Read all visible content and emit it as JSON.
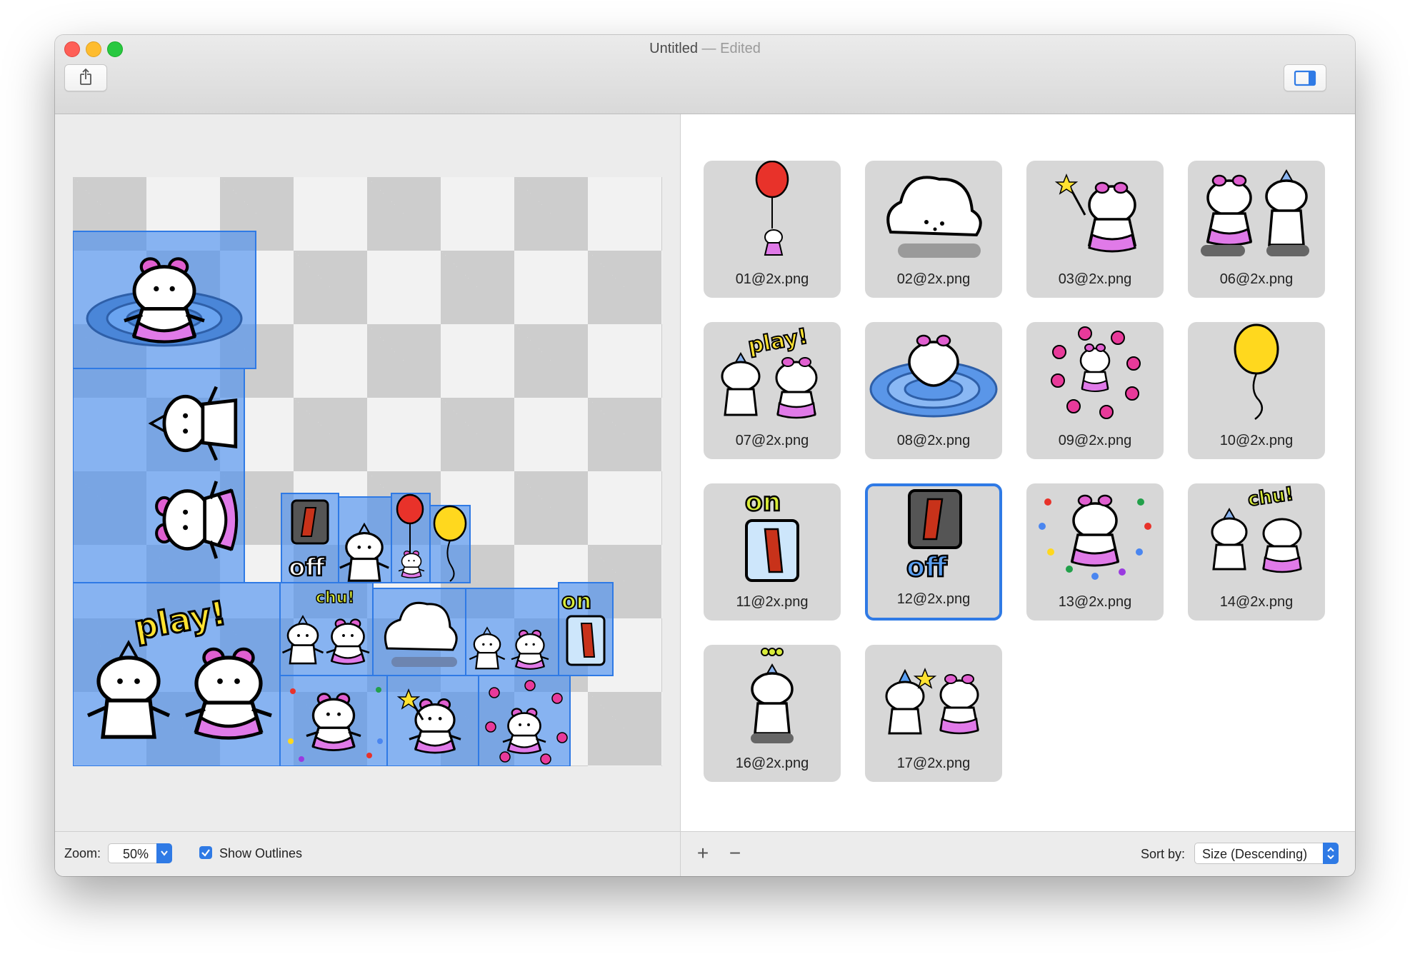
{
  "window": {
    "title": "Untitled",
    "title_suffix": "— Edited"
  },
  "colors": {
    "accent": "#2f7ae5",
    "sprite_overlay": "#468cf0",
    "tile_bg": "#d7d7d7"
  },
  "toolbar": {
    "share_icon": "share-icon",
    "sidebar_icon": "sidebar-toggle-icon"
  },
  "sprites": {
    "items": [
      {
        "name": "01@2x.png",
        "motif": "balloon-red",
        "selected": false
      },
      {
        "name": "02@2x.png",
        "motif": "cloud",
        "selected": false
      },
      {
        "name": "03@2x.png",
        "motif": "wand-girl",
        "selected": false
      },
      {
        "name": "06@2x.png",
        "motif": "pair",
        "selected": false
      },
      {
        "name": "07@2x.png",
        "motif": "play-pair",
        "selected": false
      },
      {
        "name": "08@2x.png",
        "motif": "ripple-girl",
        "selected": false
      },
      {
        "name": "09@2x.png",
        "motif": "hearts-girl",
        "selected": false
      },
      {
        "name": "10@2x.png",
        "motif": "balloon-yellow",
        "selected": false
      },
      {
        "name": "11@2x.png",
        "motif": "switch-on",
        "selected": false
      },
      {
        "name": "12@2x.png",
        "motif": "switch-off",
        "selected": true
      },
      {
        "name": "13@2x.png",
        "motif": "stars-girl",
        "selected": false
      },
      {
        "name": "14@2x.png",
        "motif": "chu-pair",
        "selected": false
      },
      {
        "name": "16@2x.png",
        "motif": "dots-boy",
        "selected": false
      },
      {
        "name": "17@2x.png",
        "motif": "wand-pair",
        "selected": false
      }
    ]
  },
  "canvas_labels": {
    "play": "play!",
    "chu": "chu!",
    "on": "on",
    "off": "off"
  },
  "bottom": {
    "zoom_label": "Zoom:",
    "zoom_value": "50%",
    "show_outlines_label": "Show Outlines",
    "show_outlines_checked": true,
    "add_label": "+",
    "remove_label": "−",
    "sort_label": "Sort by:",
    "sort_value": "Size (Descending)"
  }
}
